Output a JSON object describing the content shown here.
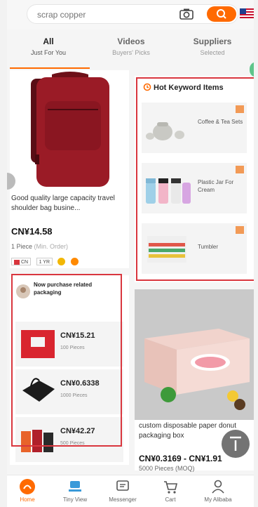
{
  "search": {
    "placeholder": "scrap copper"
  },
  "tabs": [
    {
      "label": "All",
      "sub": "Just For You"
    },
    {
      "label": "Videos",
      "sub": "Buyers' Picks"
    },
    {
      "label": "Suppliers",
      "sub": "Selected"
    }
  ],
  "product1": {
    "title": "Good quality large capacity travel shoulder bag busine...",
    "price": "CN¥14.58",
    "moq": "1 Piece",
    "moq_note": "(Min. Order)",
    "badges": [
      "CN",
      "1 YR"
    ]
  },
  "hot_keywords": {
    "title": "Hot Keyword Items",
    "items": [
      {
        "label": "Coffee & Tea Sets"
      },
      {
        "label": "Plastic Jar For Cream"
      },
      {
        "label": "Tumbler"
      }
    ]
  },
  "now_purchase": {
    "title": "Now purchase related packaging",
    "items": [
      {
        "price": "CN¥15.21",
        "qty": "100 Pieces"
      },
      {
        "price": "CN¥0.6338",
        "qty": "1000 Pieces"
      },
      {
        "price": "CN¥42.27",
        "qty": "500 Pieces"
      }
    ]
  },
  "product2": {
    "title": "custom disposable paper donut packaging box",
    "price": "CN¥0.3169 - CN¥1.91",
    "moq": "5000 Pieces (MOQ)"
  },
  "bottom_nav": [
    {
      "label": "Home",
      "icon": "home-icon"
    },
    {
      "label": "Tiny View",
      "icon": "tiny-view-icon"
    },
    {
      "label": "Messenger",
      "icon": "messenger-icon"
    },
    {
      "label": "Cart",
      "icon": "cart-icon"
    },
    {
      "label": "My Alibaba",
      "icon": "profile-icon"
    }
  ],
  "colors": {
    "accent": "#ff6a00",
    "highlight_box": "#d9363e"
  }
}
